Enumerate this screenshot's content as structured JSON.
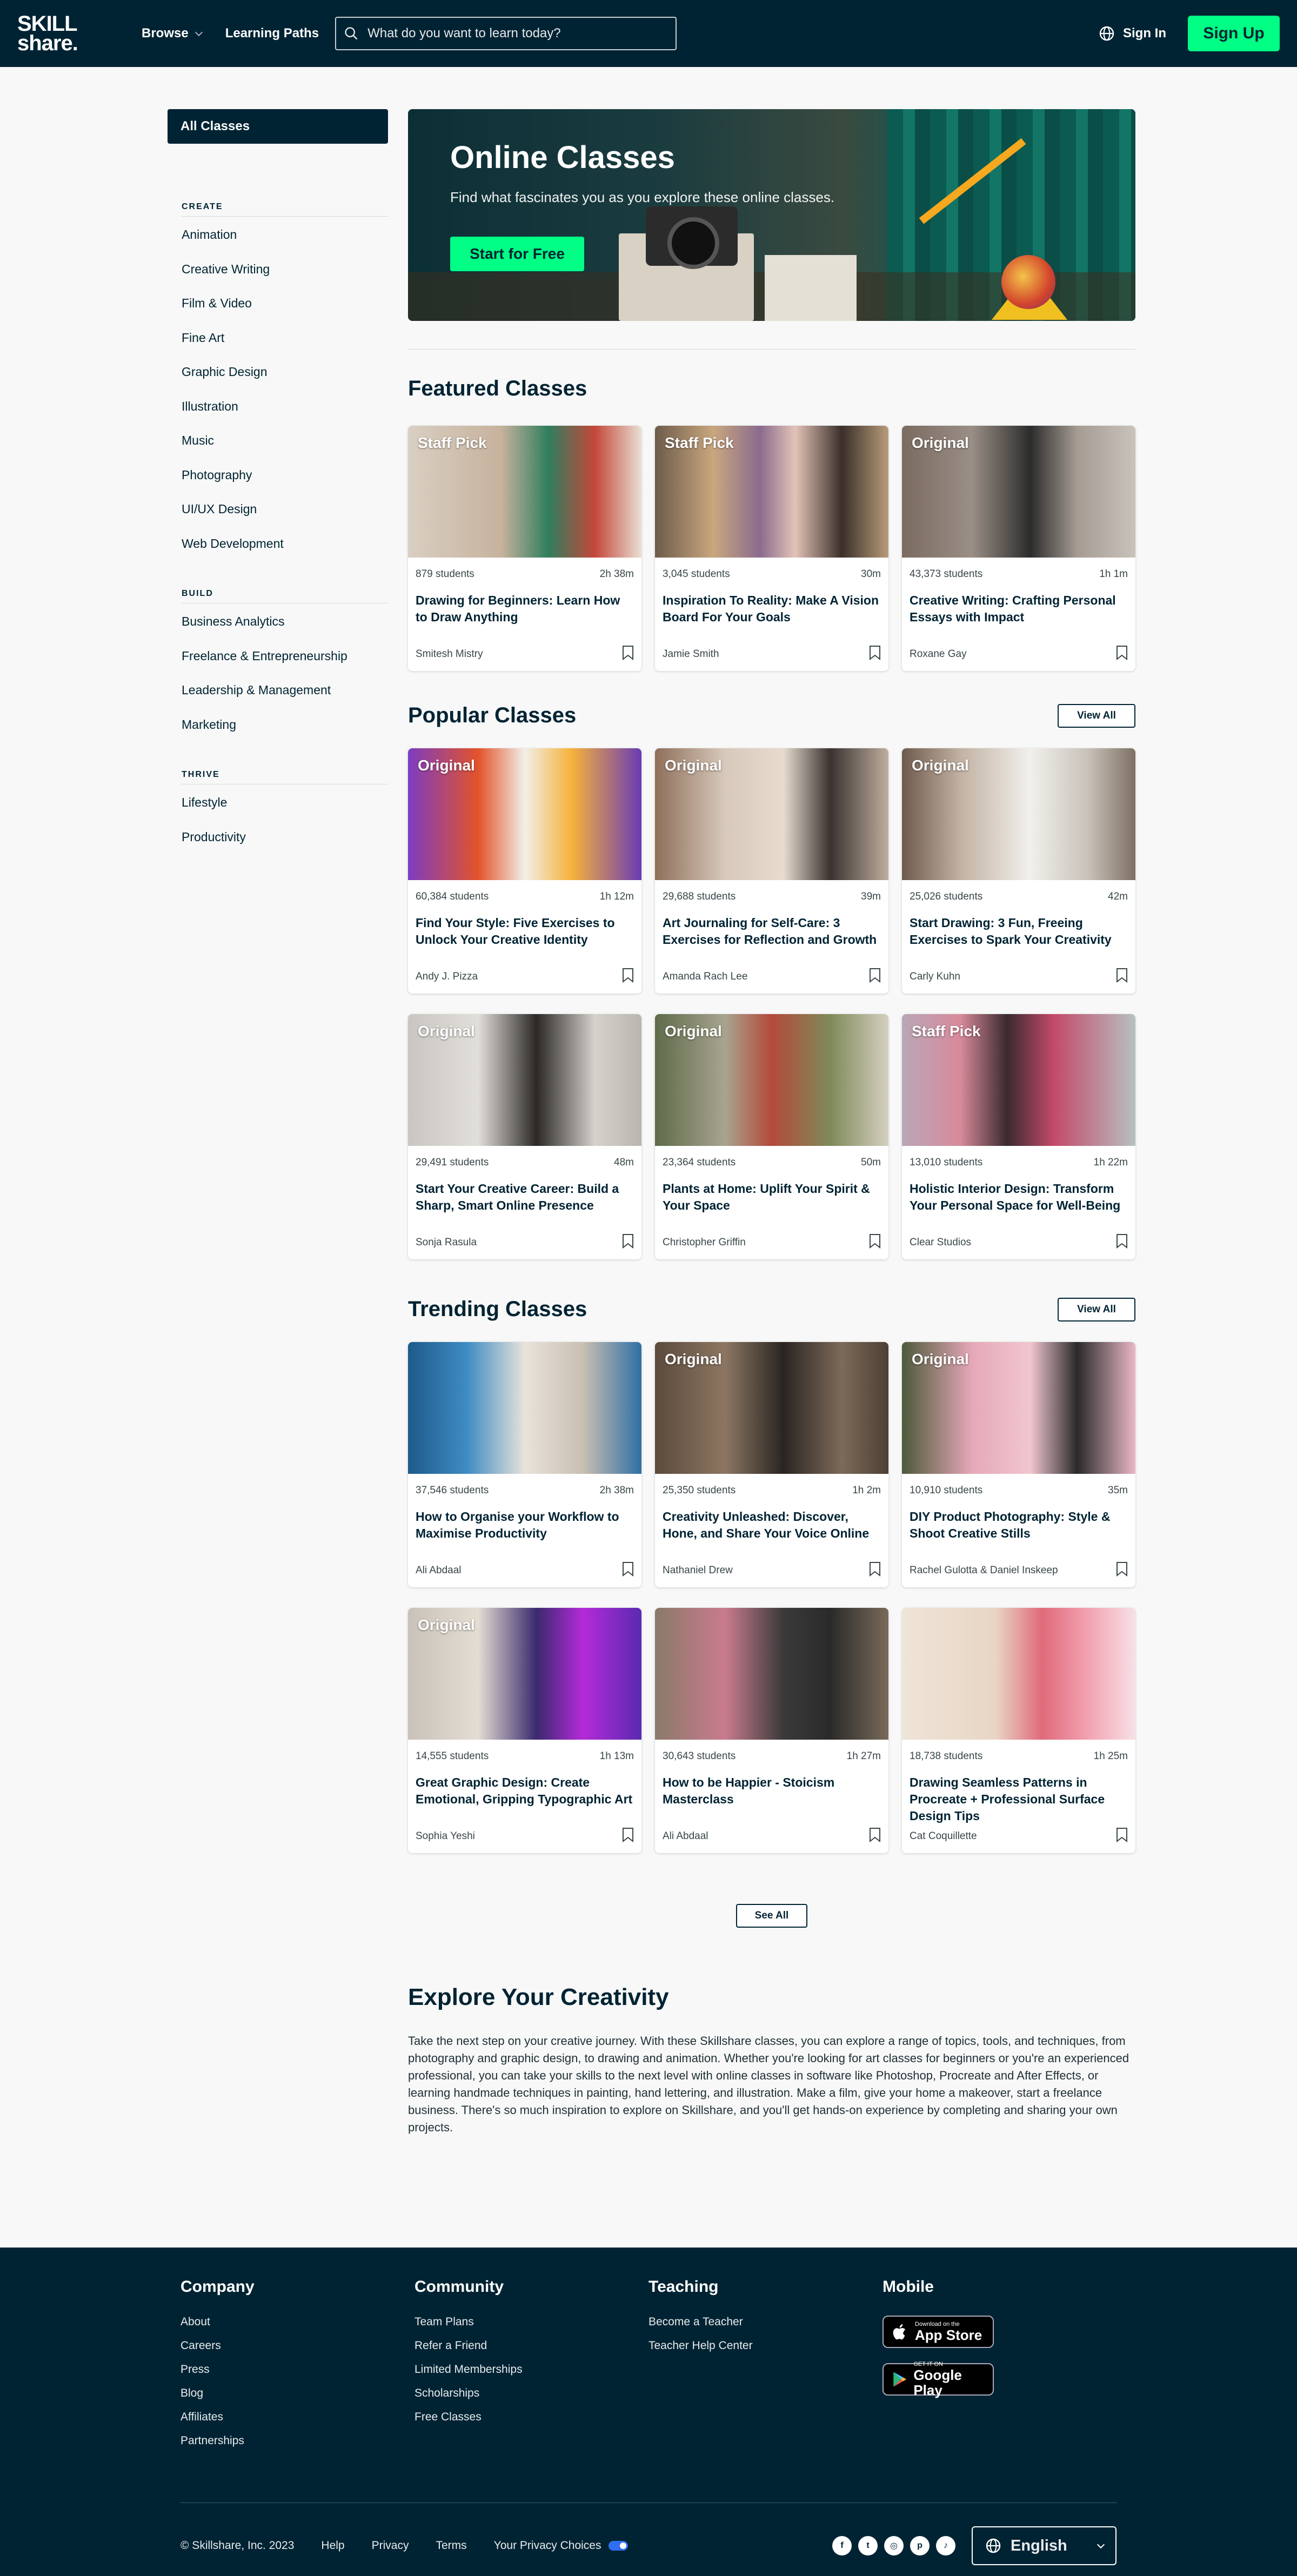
{
  "header": {
    "logo_line1": "SKILL",
    "logo_line2": "share.",
    "browse": "Browse",
    "learning_paths": "Learning Paths",
    "search_placeholder": "What do you want to learn today?",
    "sign_in": "Sign In",
    "sign_up": "Sign Up"
  },
  "sidebar": {
    "all_classes": "All Classes",
    "sections": [
      {
        "heading": "CREATE",
        "items": [
          "Animation",
          "Creative Writing",
          "Film & Video",
          "Fine Art",
          "Graphic Design",
          "Illustration",
          "Music",
          "Photography",
          "UI/UX Design",
          "Web Development"
        ]
      },
      {
        "heading": "BUILD",
        "items": [
          "Business Analytics",
          "Freelance & Entrepreneurship",
          "Leadership & Management",
          "Marketing"
        ]
      },
      {
        "heading": "THRIVE",
        "items": [
          "Lifestyle",
          "Productivity"
        ]
      }
    ]
  },
  "hero": {
    "title": "Online Classes",
    "subtitle": "Find what fascinates you as you explore these online classes.",
    "cta": "Start for Free"
  },
  "featured": {
    "title": "Featured Classes",
    "cards": [
      {
        "badge": "Staff Pick",
        "students": "879 students",
        "duration": "2h 38m",
        "title": "Drawing for Beginners: Learn How to Draw Anything",
        "author": "Smitesh Mistry",
        "bg": "linear-gradient(90deg,#d9cfc2 0%,#c7b29d 40%,#2f7e5e 60%,#c4473a 80%,#e9e0d4 100%)"
      },
      {
        "badge": "Staff Pick",
        "students": "3,045 students",
        "duration": "30m",
        "title": "Inspiration To Reality: Make A Vision Board For Your Goals",
        "author": "Jamie Smith",
        "bg": "linear-gradient(90deg,#6d5b4b 0%,#c9a77e 25%,#8a6b8e 45%,#e3c3b7 60%,#3a2f2a 80%,#b89b7a 100%)"
      },
      {
        "badge": "Original",
        "students": "43,373 students",
        "duration": "1h 1m",
        "title": "Creative Writing: Crafting Personal Essays with Impact",
        "author": "Roxane Gay",
        "bg": "linear-gradient(90deg,#7b6b61 0%,#9a8e86 30%,#2c2c2c 55%,#a59b93 75%,#c9c3bc 100%)"
      }
    ]
  },
  "popular": {
    "title": "Popular Classes",
    "view_all": "View All",
    "cards": [
      {
        "badge": "Original",
        "students": "60,384 students",
        "duration": "1h 12m",
        "title": "Find Your Style: Five Exercises to Unlock Your Creative Identity",
        "author": "Andy J. Pizza",
        "bg": "linear-gradient(90deg,#7d3cc2 0%,#e2532a 30%,#f2efe8 50%,#f6b23a 70%,#6a3bb6 100%)"
      },
      {
        "badge": "Original",
        "students": "29,688 students",
        "duration": "39m",
        "title": "Art Journaling for Self-Care: 3 Exercises for Reflection and Growth",
        "author": "Amanda Rach Lee",
        "bg": "linear-gradient(90deg,#8f6f5a 0%,#d7c9bb 30%,#e7dccf 55%,#3a3230 75%,#bfae9e 100%)"
      },
      {
        "badge": "Original",
        "students": "25,026 students",
        "duration": "42m",
        "title": "Start Drawing: 3 Fun, Freeing Exercises to Spark Your Creativity",
        "author": "Carly Kuhn",
        "bg": "linear-gradient(90deg,#6e5a4d 0%,#c2b2a3 25%,#f2f0ec 55%,#c7c1b9 80%,#7e6f63 100%)"
      },
      {
        "badge": "Original",
        "students": "29,491 students",
        "duration": "48m",
        "title": "Start Your Creative Career: Build a Sharp, Smart Online Presence",
        "author": "Sonja Rasula",
        "bg": "linear-gradient(90deg,#c9c6c2 0%,#e2dfdb 30%,#2b2826 55%,#d5d1cc 80%,#b9b5b0 100%)"
      },
      {
        "badge": "Original",
        "students": "23,364 students",
        "duration": "50m",
        "title": "Plants at Home: Uplift Your Spirit & Your Space",
        "author": "Christopher Griffin",
        "bg": "linear-gradient(90deg,#5e6b4a 0%,#a8a38f 30%,#b34a3a 50%,#7e8a5a 75%,#d5cfc0 100%)"
      },
      {
        "badge": "Staff Pick",
        "students": "13,010 students",
        "duration": "1h 22m",
        "title": "Holistic Interior Design: Transform Your Personal Space for Well-Being",
        "author": "Clear Studios",
        "bg": "linear-gradient(90deg,#b9a6b8 0%,#d88a9a 25%,#3a2a2e 45%,#c34a6a 65%,#b7c0c0 100%)"
      }
    ]
  },
  "trending": {
    "title": "Trending Classes",
    "view_all": "View All",
    "cards": [
      {
        "badge": "",
        "students": "37,546 students",
        "duration": "2h 38m",
        "title": "How to Organise your Workflow to Maximise Productivity",
        "author": "Ali Abdaal",
        "bg": "linear-gradient(90deg,#1e5a8a 0%,#3e8bc2 25%,#e8e3da 50%,#c9bfb2 75%,#2f6fa6 100%)"
      },
      {
        "badge": "Original",
        "students": "25,350 students",
        "duration": "1h 2m",
        "title": "Creativity Unleashed: Discover, Hone, and Share Your Voice Online",
        "author": "Nathaniel Drew",
        "bg": "linear-gradient(90deg,#5c4a3c 0%,#8c7662 30%,#2a2522 55%,#7d6a58 80%,#4c3f34 100%)"
      },
      {
        "badge": "Original",
        "students": "10,910 students",
        "duration": "35m",
        "title": "DIY Product Photography: Style & Shoot Creative Stills",
        "author": "Rachel Gulotta & Daniel Inskeep",
        "bg": "linear-gradient(90deg,#4c5a3a 0%,#e6a8b8 30%,#f1c6cf 55%,#2a2a2a 75%,#e9b8c6 100%)"
      },
      {
        "badge": "Original",
        "students": "14,555 students",
        "duration": "1h 13m",
        "title": "Great Graphic Design: Create Emotional, Gripping Typographic Art",
        "author": "Sophia Yeshi",
        "bg": "linear-gradient(90deg,#c9c2b8 0%,#e4ddd2 30%,#3a2a6e 55%,#b42ad8 75%,#5a2ab0 100%)"
      },
      {
        "badge": "",
        "students": "30,643 students",
        "duration": "1h 27m",
        "title": "How to be Happier - Stoicism Masterclass",
        "author": "Ali Abdaal",
        "bg": "linear-gradient(90deg,#8a7a6a 0%,#c97b8e 30%,#3a3a3a 55%,#2a2a2a 75%,#7a6a5a 100%)"
      },
      {
        "badge": "",
        "students": "18,738 students",
        "duration": "1h 25m",
        "title": "Drawing Seamless Patterns in Procreate + Professional Surface Design Tips",
        "author": "Cat Coquillette",
        "bg": "linear-gradient(90deg,#efe4d8 0%,#e8d6c4 40%,#e06a7a 60%,#f2a3b2 80%,#f7e1e6 100%)"
      }
    ]
  },
  "see_all": "See All",
  "explore": {
    "title": "Explore Your Creativity",
    "body": "Take the next step on your creative journey. With these Skillshare classes, you can explore a range of topics, tools, and techniques, from photography and graphic design, to drawing and animation. Whether you're looking for art classes for beginners or you're an experienced professional, you can take your skills to the next level with online classes in software like Photoshop, Procreate and After Effects, or learning handmade techniques in painting, hand lettering, and illustration. Make a film, give your home a makeover, start a freelance business. There's so much inspiration to explore on Skillshare, and you'll get hands-on experience by completing and sharing your own projects."
  },
  "footer": {
    "company": {
      "heading": "Company",
      "links": [
        "About",
        "Careers",
        "Press",
        "Blog",
        "Affiliates",
        "Partnerships"
      ]
    },
    "community": {
      "heading": "Community",
      "links": [
        "Team Plans",
        "Refer a Friend",
        "Limited Memberships",
        "Scholarships",
        "Free Classes"
      ]
    },
    "teaching": {
      "heading": "Teaching",
      "links": [
        "Become a Teacher",
        "Teacher Help Center"
      ]
    },
    "mobile": {
      "heading": "Mobile",
      "app_store_small": "Download on the",
      "app_store_big": "App Store",
      "google_small": "GET IT ON",
      "google_big": "Google Play"
    },
    "copyright": "© Skillshare, Inc. 2023",
    "help": "Help",
    "privacy": "Privacy",
    "terms": "Terms",
    "privacy_choices": "Your Privacy Choices",
    "language": "English"
  },
  "colors": {
    "brand_dark": "#002333",
    "accent_green": "#00ff84"
  }
}
